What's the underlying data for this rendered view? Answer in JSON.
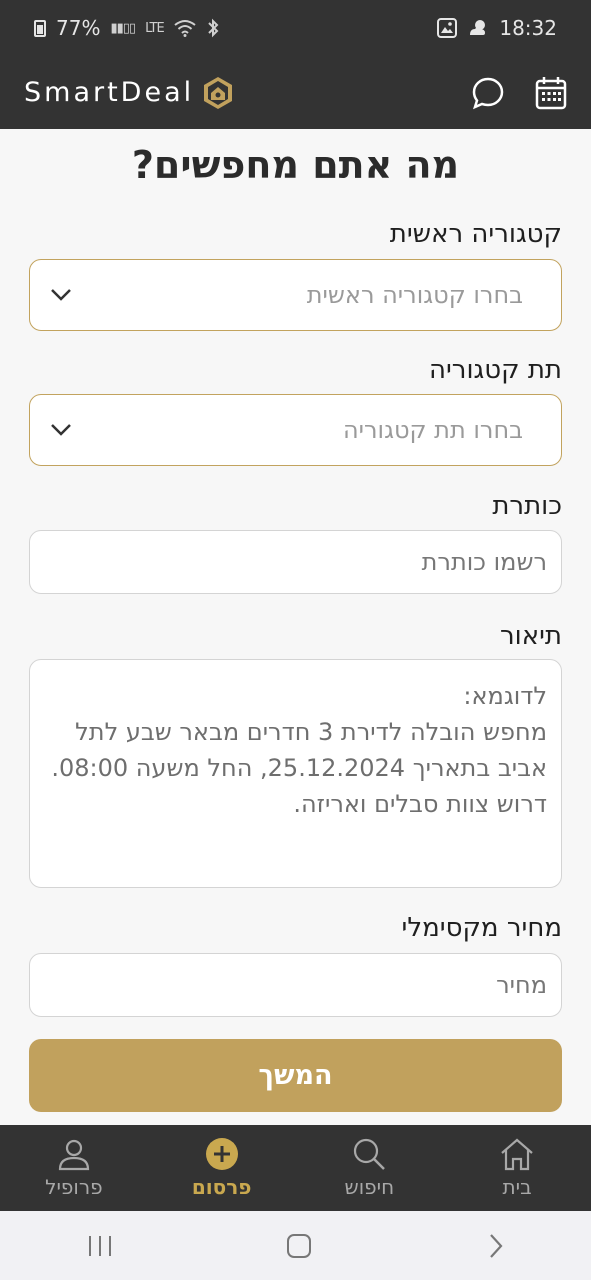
{
  "status_bar": {
    "battery": "77%",
    "network": "LTE",
    "time": "18:32"
  },
  "header": {
    "brand": "SmartDeal",
    "icons": [
      "chat-icon",
      "calendar-icon"
    ]
  },
  "form": {
    "title": "מה אתם מחפשים?",
    "main_category": {
      "label": "קטגוריה ראשית",
      "placeholder": "בחרו קטגוריה ראשית"
    },
    "sub_category": {
      "label": "תת קטגוריה",
      "placeholder": "בחרו תת קטגוריה"
    },
    "title_field": {
      "label": "כותרת",
      "placeholder": "רשמו כותרת"
    },
    "description": {
      "label": "תיאור",
      "placeholder_lines": [
        "לדוגמא:",
        "מחפש הובלה לדירת 3 חדרים מבאר שבע לתל",
        "אביב בתאריך 25.12.2024, החל משעה 08:00.",
        "דרוש צוות סבלים ואריזה."
      ]
    },
    "max_price": {
      "label": "מחיר מקסימלי",
      "placeholder": "מחיר"
    },
    "continue_label": "המשך"
  },
  "bottom_nav": {
    "items": [
      {
        "label": "פרופיל",
        "icon": "user-icon"
      },
      {
        "label": "פרסום",
        "icon": "plus-circle-icon",
        "active": true
      },
      {
        "label": "חיפוש",
        "icon": "search-icon"
      },
      {
        "label": "בית",
        "icon": "home-icon"
      }
    ]
  },
  "colors": {
    "dark": "#333333",
    "gold": "#c1a15d",
    "active_nav": "#c9a84f"
  }
}
